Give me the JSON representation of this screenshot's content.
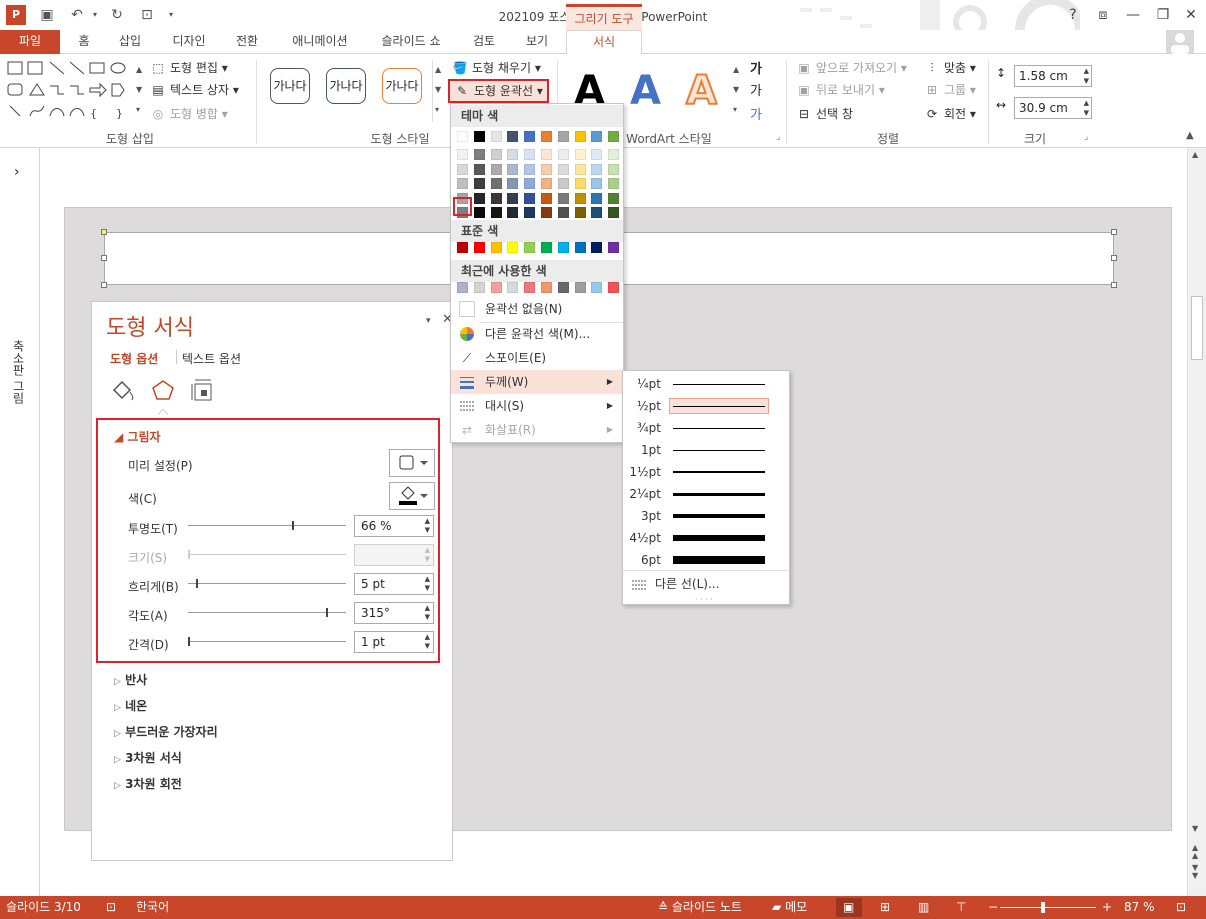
{
  "title": "202109 포스팅용 완성본 - PowerPoint",
  "context_tab": "그리기 도구",
  "window_controls": {
    "help": "?",
    "restore_ribbon": "⧈",
    "minimize": "—",
    "maximize": "❐",
    "close": "✕"
  },
  "tabs": [
    "파일",
    "홈",
    "삽입",
    "디자인",
    "전환",
    "애니메이션",
    "슬라이드 쇼",
    "검토",
    "보기",
    "서식"
  ],
  "ribbon": {
    "shape_insert": {
      "edit_shape": "도형 편집",
      "text_box": "텍스트 상자",
      "merge_shapes": "도형 병합",
      "label": "도형 삽입"
    },
    "shape_styles": {
      "samples": [
        "가나다",
        "가나다",
        "가나다"
      ],
      "fill": "도형 채우기",
      "outline": "도형 윤곽선",
      "label": "도형 스타일"
    },
    "wordart": {
      "letters": [
        "A",
        "A",
        "A"
      ],
      "label": "WordArt 스타일"
    },
    "arrange": {
      "bring_forward": "앞으로 가져오기",
      "send_backward": "뒤로 보내기",
      "selection_pane": "선택 창",
      "align": "맞춤",
      "group": "그룹",
      "rotate": "회전",
      "label": "정렬"
    },
    "size": {
      "height": "1.58 cm",
      "width": "30.9 cm",
      "label": "크기"
    }
  },
  "left_pane": {
    "label": "축소판 그림",
    "toggle": "›"
  },
  "format_pane": {
    "title": "도형 서식",
    "tabs": [
      "도형 옵션",
      "텍스트 옵션"
    ],
    "shadow": {
      "header": "그림자",
      "preset": "미리 설정(P)",
      "color": "색(C)",
      "transparency": {
        "label": "투명도(T)",
        "value": "66 %",
        "fraction": 0.66
      },
      "size": {
        "label": "크기(S)",
        "value": ""
      },
      "blur": {
        "label": "흐리게(B)",
        "value": "5 pt",
        "fraction": 0.05
      },
      "angle": {
        "label": "각도(A)",
        "value": "315°",
        "fraction": 0.875
      },
      "distance": {
        "label": "간격(D)",
        "value": "1 pt",
        "fraction": 0.0
      }
    },
    "sections": [
      "반사",
      "네온",
      "부드러운 가장자리",
      "3차원 서식",
      "3차원 회전"
    ]
  },
  "outline_menu": {
    "theme_colors": "테마 색",
    "standard_colors": "표준 색",
    "recent_colors": "최근에 사용한 색",
    "no_outline": "윤곽선 없음(N)",
    "more_colors": "다른 윤곽선 색(M)...",
    "eyedropper": "스포이트(E)",
    "weight": "두께(W)",
    "dash": "대시(S)",
    "arrows": "화살표(R)",
    "theme_top": [
      "#ffffff",
      "#000000",
      "#e7e6e6",
      "#44546a",
      "#4472c4",
      "#ed7d31",
      "#a5a5a5",
      "#ffc000",
      "#5b9bd5",
      "#70ad47"
    ],
    "theme_shades": [
      [
        "#f2f2f2",
        "#7f7f7f",
        "#d0cece",
        "#d6dce4",
        "#d9e2f3",
        "#fbe5d5",
        "#ededed",
        "#fff2cc",
        "#deebf6",
        "#e2efd9"
      ],
      [
        "#d8d8d8",
        "#595959",
        "#aeabab",
        "#adb9ca",
        "#b4c6e7",
        "#f7cbac",
        "#dbdbdb",
        "#fee599",
        "#bdd7ee",
        "#c5e0b3"
      ],
      [
        "#bfbfbf",
        "#3f3f3f",
        "#757070",
        "#8496b0",
        "#8eaadb",
        "#f4b183",
        "#c9c9c9",
        "#ffd965",
        "#9dc3e6",
        "#a8d08d"
      ],
      [
        "#a5a5a5",
        "#262626",
        "#3a3838",
        "#323f4f",
        "#2f5496",
        "#c55a11",
        "#7b7b7b",
        "#bf9000",
        "#2e75b5",
        "#538135"
      ],
      [
        "#7f7f7f",
        "#0c0c0c",
        "#171616",
        "#222a35",
        "#1f3864",
        "#833c0b",
        "#525252",
        "#7f6000",
        "#1e4e79",
        "#375623"
      ]
    ],
    "standard": [
      "#c00000",
      "#ff0000",
      "#ffc000",
      "#ffff00",
      "#92d050",
      "#00b050",
      "#00b0f0",
      "#0070c0",
      "#002060",
      "#7030a0"
    ],
    "recent": [
      "#a9b4c6",
      "#d4d4d4",
      "#f4a0a0",
      "#d5d9e0",
      "#ee7777",
      "#f3956e",
      "#6e6470",
      "#a39ba4",
      "#9ac7e8",
      "#f05454"
    ]
  },
  "weight_menu": {
    "items": [
      {
        "label": "¼pt",
        "width": 0.25
      },
      {
        "label": "½pt",
        "width": 0.5
      },
      {
        "label": "¾pt",
        "width": 0.75
      },
      {
        "label": "1pt",
        "width": 1
      },
      {
        "label": "1½pt",
        "width": 1.5
      },
      {
        "label": "2¼pt",
        "width": 2.25
      },
      {
        "label": "3pt",
        "width": 3
      },
      {
        "label": "4½pt",
        "width": 4.5
      },
      {
        "label": "6pt",
        "width": 6
      }
    ],
    "more_lines": "다른 선(L)..."
  },
  "status": {
    "slide": "슬라이드 3/10",
    "language": "한국어",
    "notes": "슬라이드 노트",
    "comments": "메모",
    "zoom": "87 %",
    "zoom_minus": "−",
    "zoom_plus": "+"
  }
}
